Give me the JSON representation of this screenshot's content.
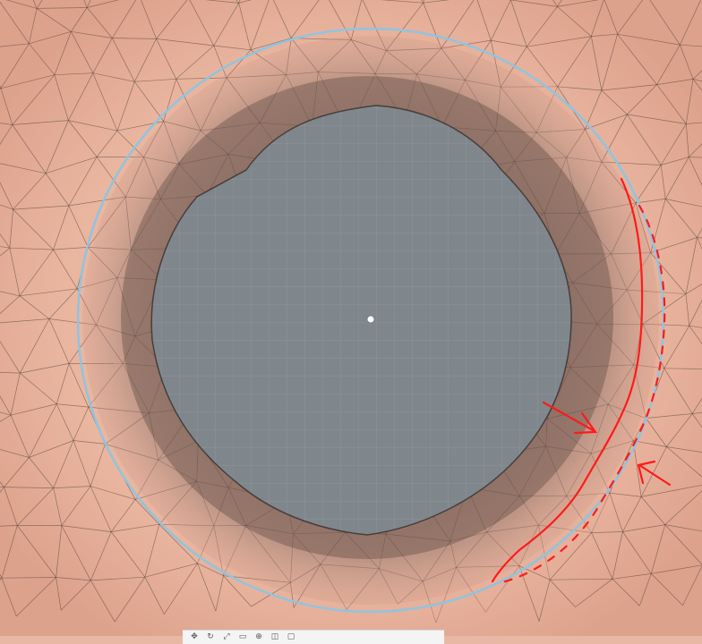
{
  "viewport": {
    "mesh_color": "#d9a593",
    "wire_color": "#4a3a36",
    "hole_color": "#7f878c",
    "rim_shadow_color": "#5b4a45",
    "guide_circle_color": "#8fc4e0",
    "annotation_color": "#ff1a1a",
    "pivot_color": "#ffffff"
  },
  "toolbar": {
    "icons": [
      "move-icon",
      "rotate-icon",
      "scale-icon",
      "rect-icon",
      "transform-icon",
      "view-icon",
      "frame-icon"
    ]
  }
}
